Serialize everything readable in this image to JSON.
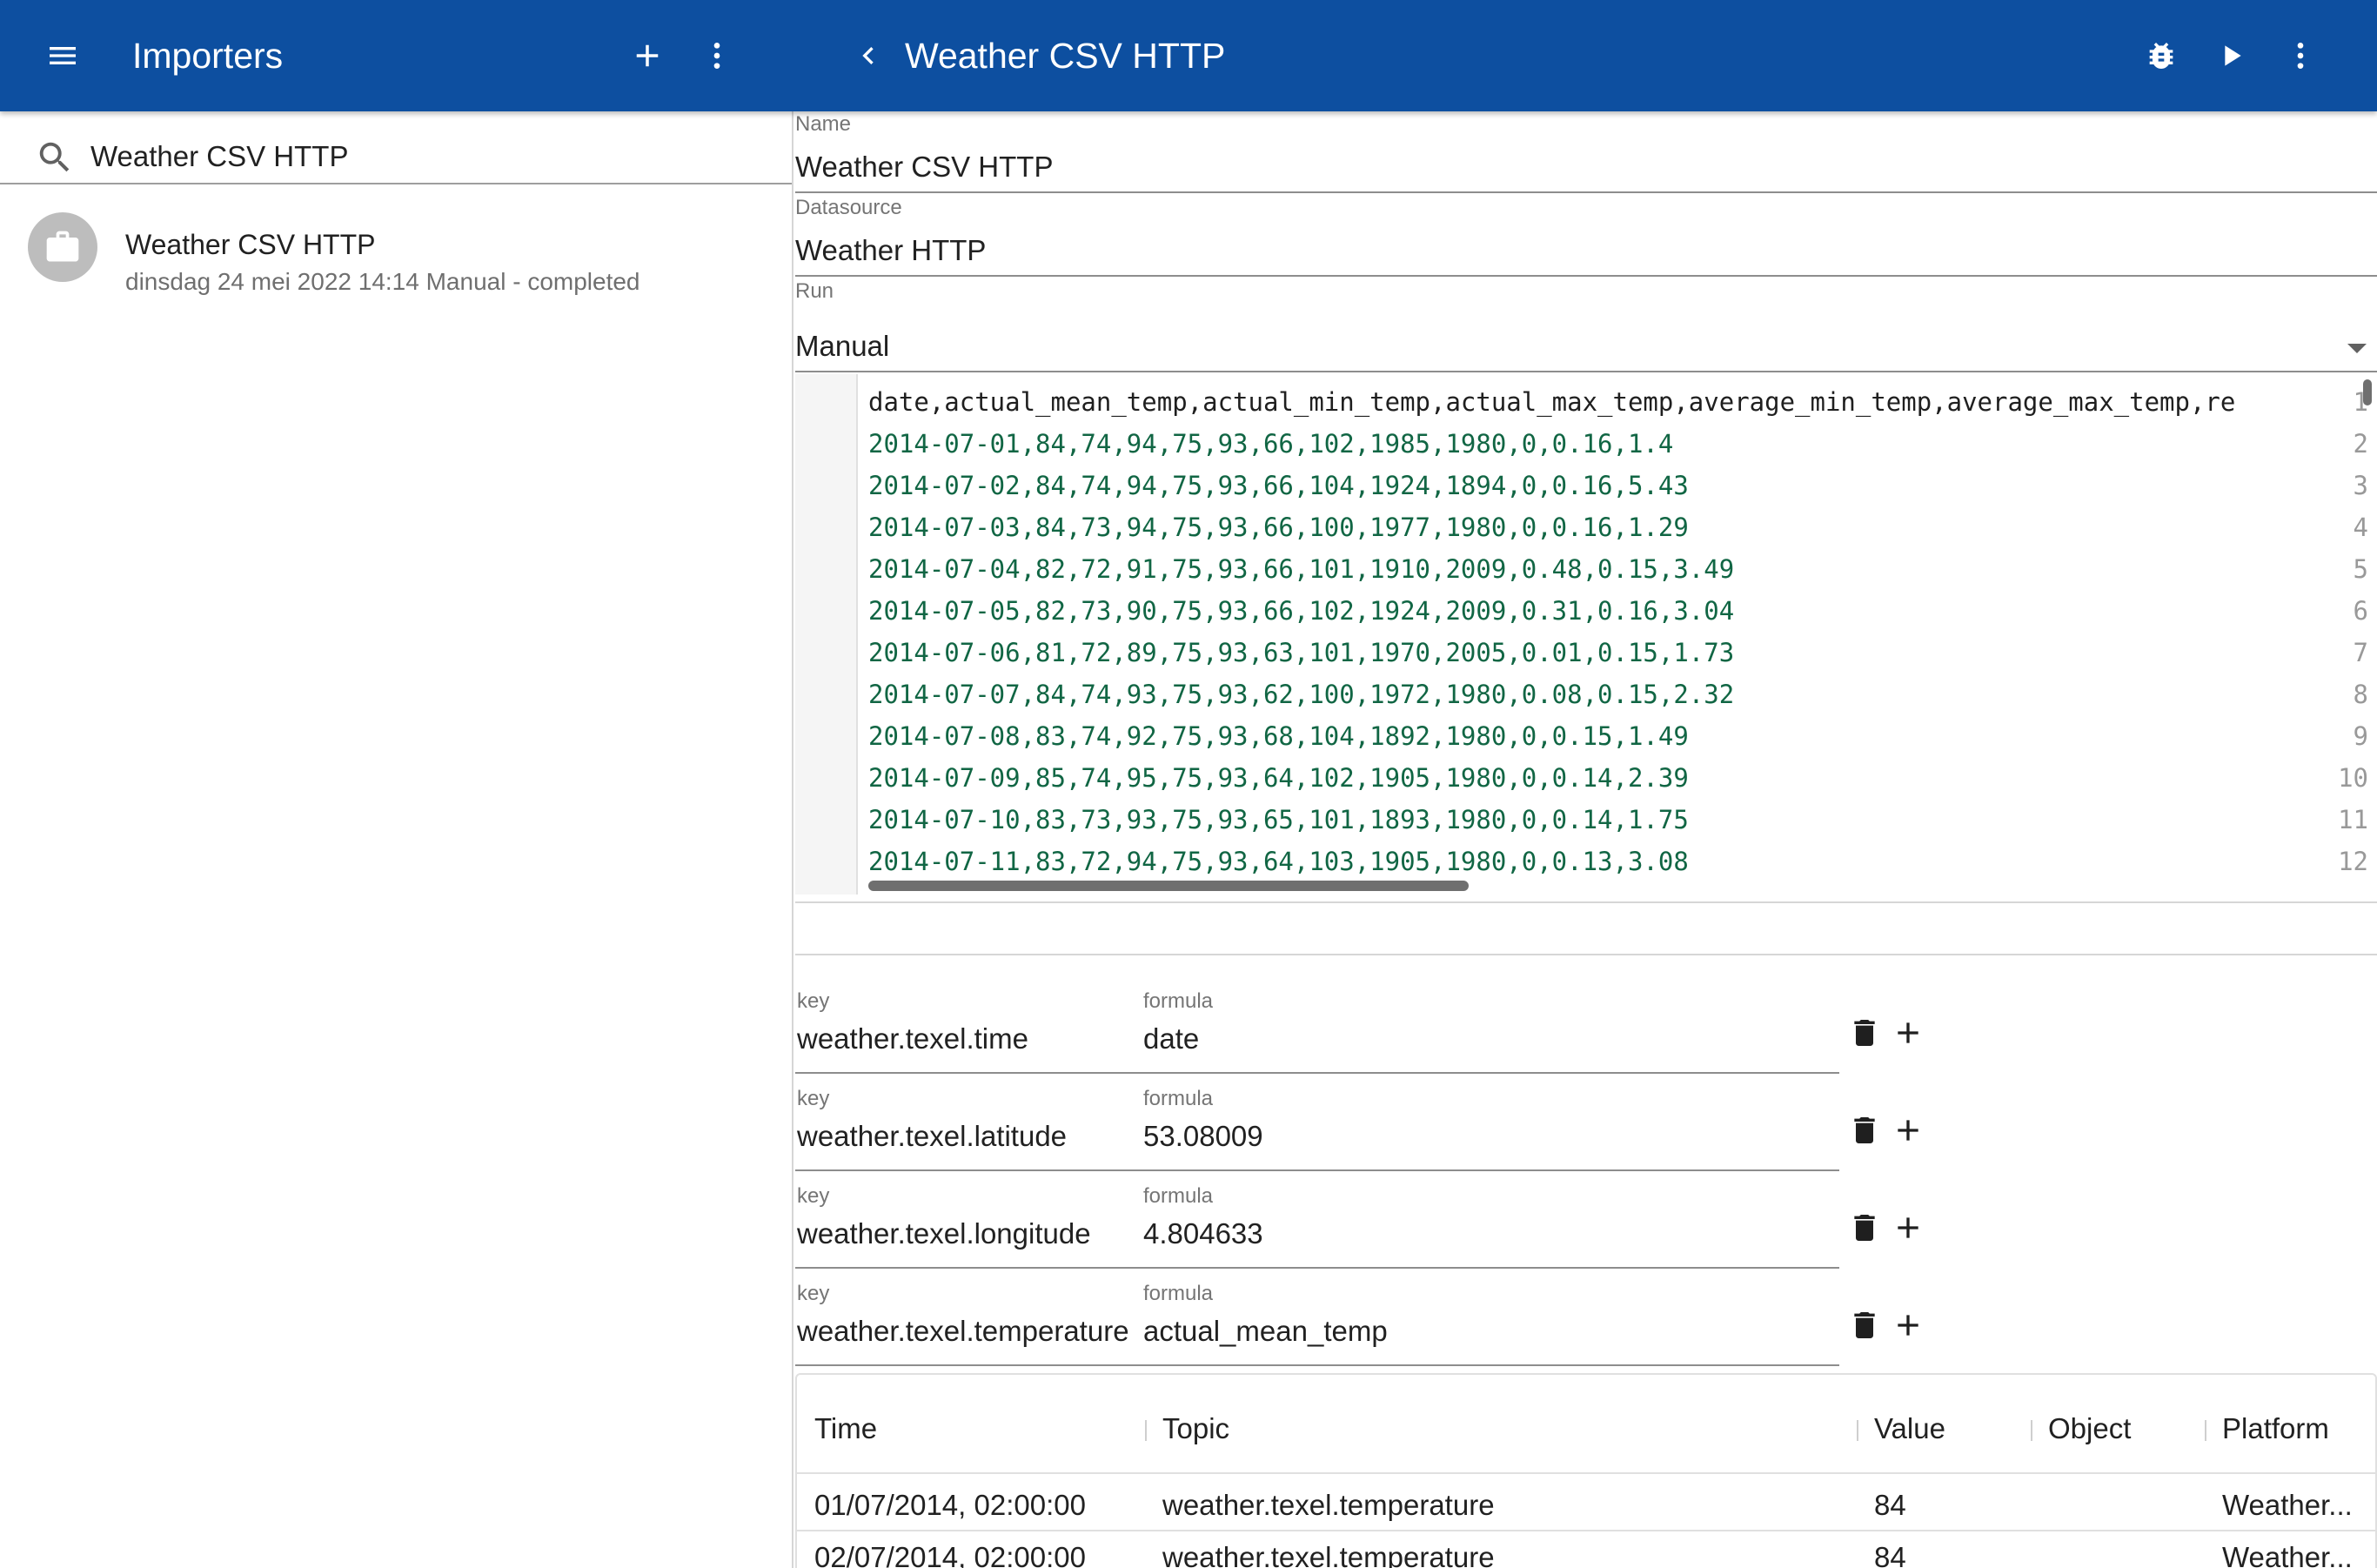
{
  "appbar": {
    "left_title": "Importers",
    "right_title": "Weather CSV HTTP",
    "icons": [
      "menu-icon",
      "add-icon",
      "more-vert-icon",
      "chevron-left-icon",
      "bug-icon",
      "play-icon",
      "more-vert-icon"
    ],
    "color": "#0d4fa0"
  },
  "search": {
    "value": "Weather CSV HTTP"
  },
  "list": {
    "items": [
      {
        "title": "Weather CSV HTTP",
        "subtitle": "dinsdag 24 mei 2022 14:14 Manual - completed",
        "icon": "briefcase-icon"
      }
    ]
  },
  "form": {
    "name_label": "Name",
    "name_value": "Weather CSV HTTP",
    "datasource_label": "Datasource",
    "datasource_value": "Weather HTTP",
    "run_label": "Run",
    "run_value": "Manual"
  },
  "editor": {
    "lines": [
      "date,actual_mean_temp,actual_min_temp,actual_max_temp,average_min_temp,average_max_temp,re",
      "2014-07-01,84,74,94,75,93,66,102,1985,1980,0,0.16,1.4",
      "2014-07-02,84,74,94,75,93,66,104,1924,1894,0,0.16,5.43",
      "2014-07-03,84,73,94,75,93,66,100,1977,1980,0,0.16,1.29",
      "2014-07-04,82,72,91,75,93,66,101,1910,2009,0.48,0.15,3.49",
      "2014-07-05,82,73,90,75,93,66,102,1924,2009,0.31,0.16,3.04",
      "2014-07-06,81,72,89,75,93,63,101,1970,2005,0.01,0.15,1.73",
      "2014-07-07,84,74,93,75,93,62,100,1972,1980,0.08,0.15,2.32",
      "2014-07-08,83,74,92,75,93,68,104,1892,1980,0,0.15,1.49",
      "2014-07-09,85,74,95,75,93,64,102,1905,1980,0,0.14,2.39",
      "2014-07-10,83,73,93,75,93,65,101,1893,1980,0,0.14,1.75",
      "2014-07-11,83,72,94,75,93,64,103,1905,1980,0,0.13,3.08"
    ]
  },
  "mappings": {
    "key_label": "key",
    "formula_label": "formula",
    "rows": [
      {
        "key": "weather.texel.time",
        "formula": "date"
      },
      {
        "key": "weather.texel.latitude",
        "formula": "53.08009"
      },
      {
        "key": "weather.texel.longitude",
        "formula": "4.804633"
      },
      {
        "key": "weather.texel.temperature",
        "formula": "actual_mean_temp"
      }
    ]
  },
  "results": {
    "columns": [
      "Time",
      "Topic",
      "Value",
      "Object",
      "Platform"
    ],
    "rows": [
      {
        "time": "01/07/2014, 02:00:00",
        "topic": "weather.texel.temperature",
        "value": "84",
        "object": "",
        "platform": "Weather..."
      },
      {
        "time": "02/07/2014, 02:00:00",
        "topic": "weather.texel.temperature",
        "value": "84",
        "object": "",
        "platform": "Weather..."
      }
    ]
  }
}
